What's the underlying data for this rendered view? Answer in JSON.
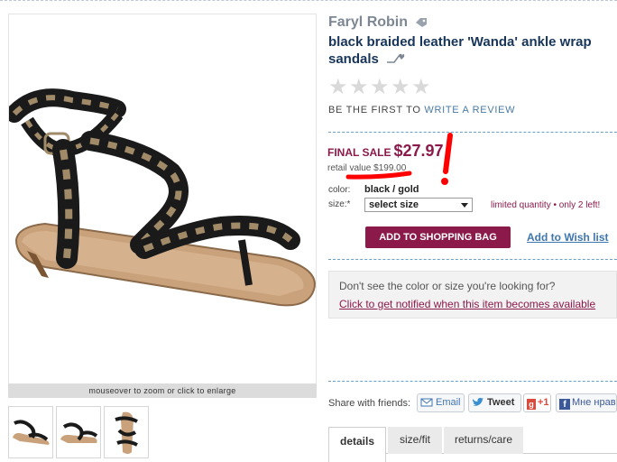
{
  "product": {
    "brand": "Faryl Robin",
    "title": "black braided leather 'Wanda' ankle wrap sandals",
    "rating_stars_filled": 0,
    "rating_stars_total": 5
  },
  "reviews": {
    "prefix": "BE THE FIRST TO",
    "link": "WRITE A REVIEW"
  },
  "pricing": {
    "final_sale_label": "FINAL SALE",
    "sale_price": "$27.97",
    "retail_value": "retail value $199.00"
  },
  "options": {
    "color_label": "color:",
    "color_value": "black / gold",
    "size_label": "size:*",
    "size_select": "select size",
    "limited_note": "limited quantity • only 2 left!"
  },
  "actions": {
    "add_to_bag": "ADD TO SHOPPING BAG",
    "wish_list": "Add to Wish list"
  },
  "notify": {
    "question": "Don't see the color or size you're looking for?",
    "link": "Click to get notified when this item becomes available"
  },
  "image": {
    "zoom_hint": "mouseover to zoom or click to enlarge"
  },
  "share": {
    "label": "Share with friends:",
    "email": "Email",
    "tweet": "Tweet",
    "gplus": "+1",
    "facebook": "Мне нрав"
  },
  "tabs": [
    "details",
    "size/fit",
    "returns/care"
  ],
  "colors": {
    "accent": "#8b1a4a",
    "link": "#3f76b0",
    "title": "#17355a",
    "annotation": "#ff0000"
  }
}
